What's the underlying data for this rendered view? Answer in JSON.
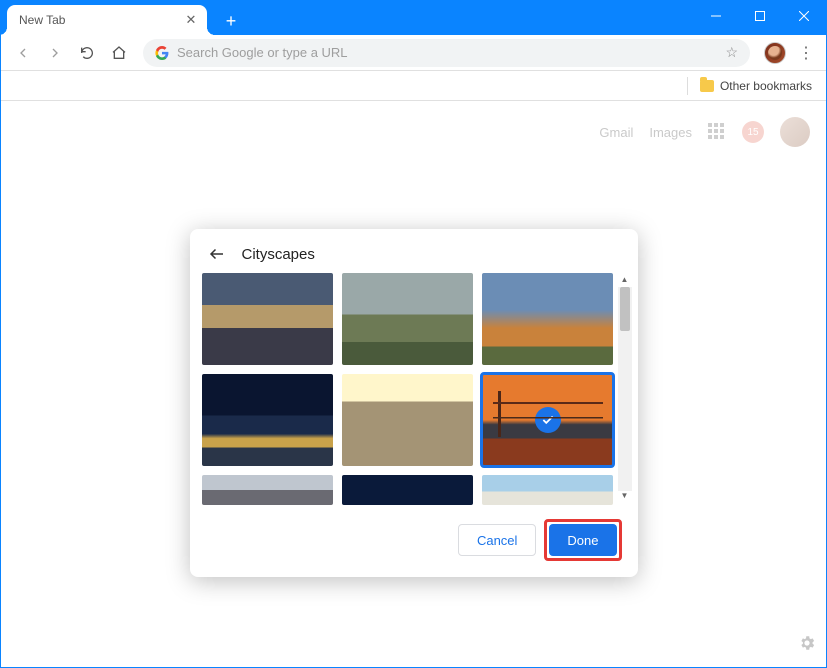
{
  "window": {
    "tab_title": "New Tab"
  },
  "toolbar": {
    "omnibox_placeholder": "Search Google or type a URL"
  },
  "bookmarks": {
    "other_label": "Other bookmarks"
  },
  "ntp": {
    "gmail": "Gmail",
    "images": "Images",
    "notif_count": "15"
  },
  "dialog": {
    "title": "Cityscapes",
    "cancel": "Cancel",
    "done": "Done",
    "selected_index": 5,
    "thumbs": [
      {
        "name": "european-street-dusk"
      },
      {
        "name": "hilltop-castle-clouds"
      },
      {
        "name": "mountain-castle-autumn"
      },
      {
        "name": "city-night-lights"
      },
      {
        "name": "cobblestone-alley-bw"
      },
      {
        "name": "golden-gate-sunset"
      },
      {
        "name": "overcast-town"
      },
      {
        "name": "deep-blue"
      },
      {
        "name": "coastal-sky"
      }
    ]
  }
}
